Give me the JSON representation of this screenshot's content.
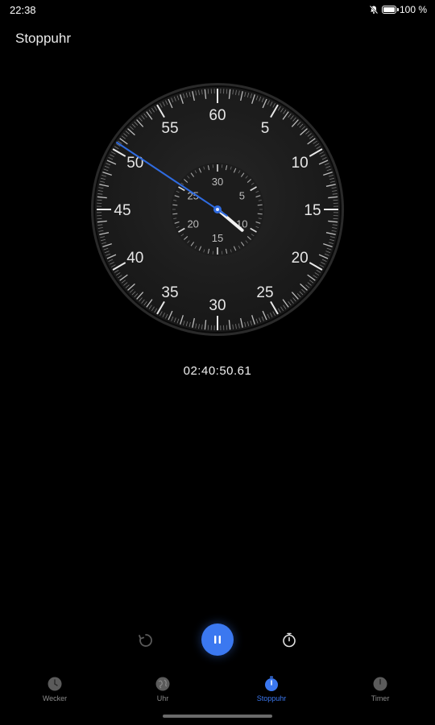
{
  "status_bar": {
    "time": "22:38",
    "battery_text": "100 %",
    "icons": [
      "bell-muted-icon",
      "battery-charging-icon"
    ],
    "battery_level": 1.0
  },
  "page": {
    "title": "Stoppuhr"
  },
  "stopwatch": {
    "readout": "02:40:50.61",
    "hand_seconds": 50.61,
    "sub_dial_minutes": 10.84,
    "outer_labels": [
      "60",
      "5",
      "10",
      "15",
      "20",
      "25",
      "30",
      "35",
      "40",
      "45",
      "50",
      "55"
    ],
    "inner_labels": [
      "30",
      "5",
      "10",
      "15",
      "20",
      "25"
    ]
  },
  "controls": {
    "reset_icon": "reset-icon",
    "pause_icon": "pause-icon",
    "lap_icon": "stopwatch-icon"
  },
  "nav": {
    "items": [
      {
        "label": "Wecker",
        "icon": "alarm-icon",
        "active": false
      },
      {
        "label": "Uhr",
        "icon": "globe-icon",
        "active": false
      },
      {
        "label": "Stoppuhr",
        "icon": "stopwatch-icon",
        "active": true
      },
      {
        "label": "Timer",
        "icon": "timer-icon",
        "active": false
      }
    ]
  },
  "colors": {
    "accent": "#3b78f0",
    "background": "#000000",
    "dial_face": "#1e1e1e",
    "hand_main": "#2f6be0"
  }
}
